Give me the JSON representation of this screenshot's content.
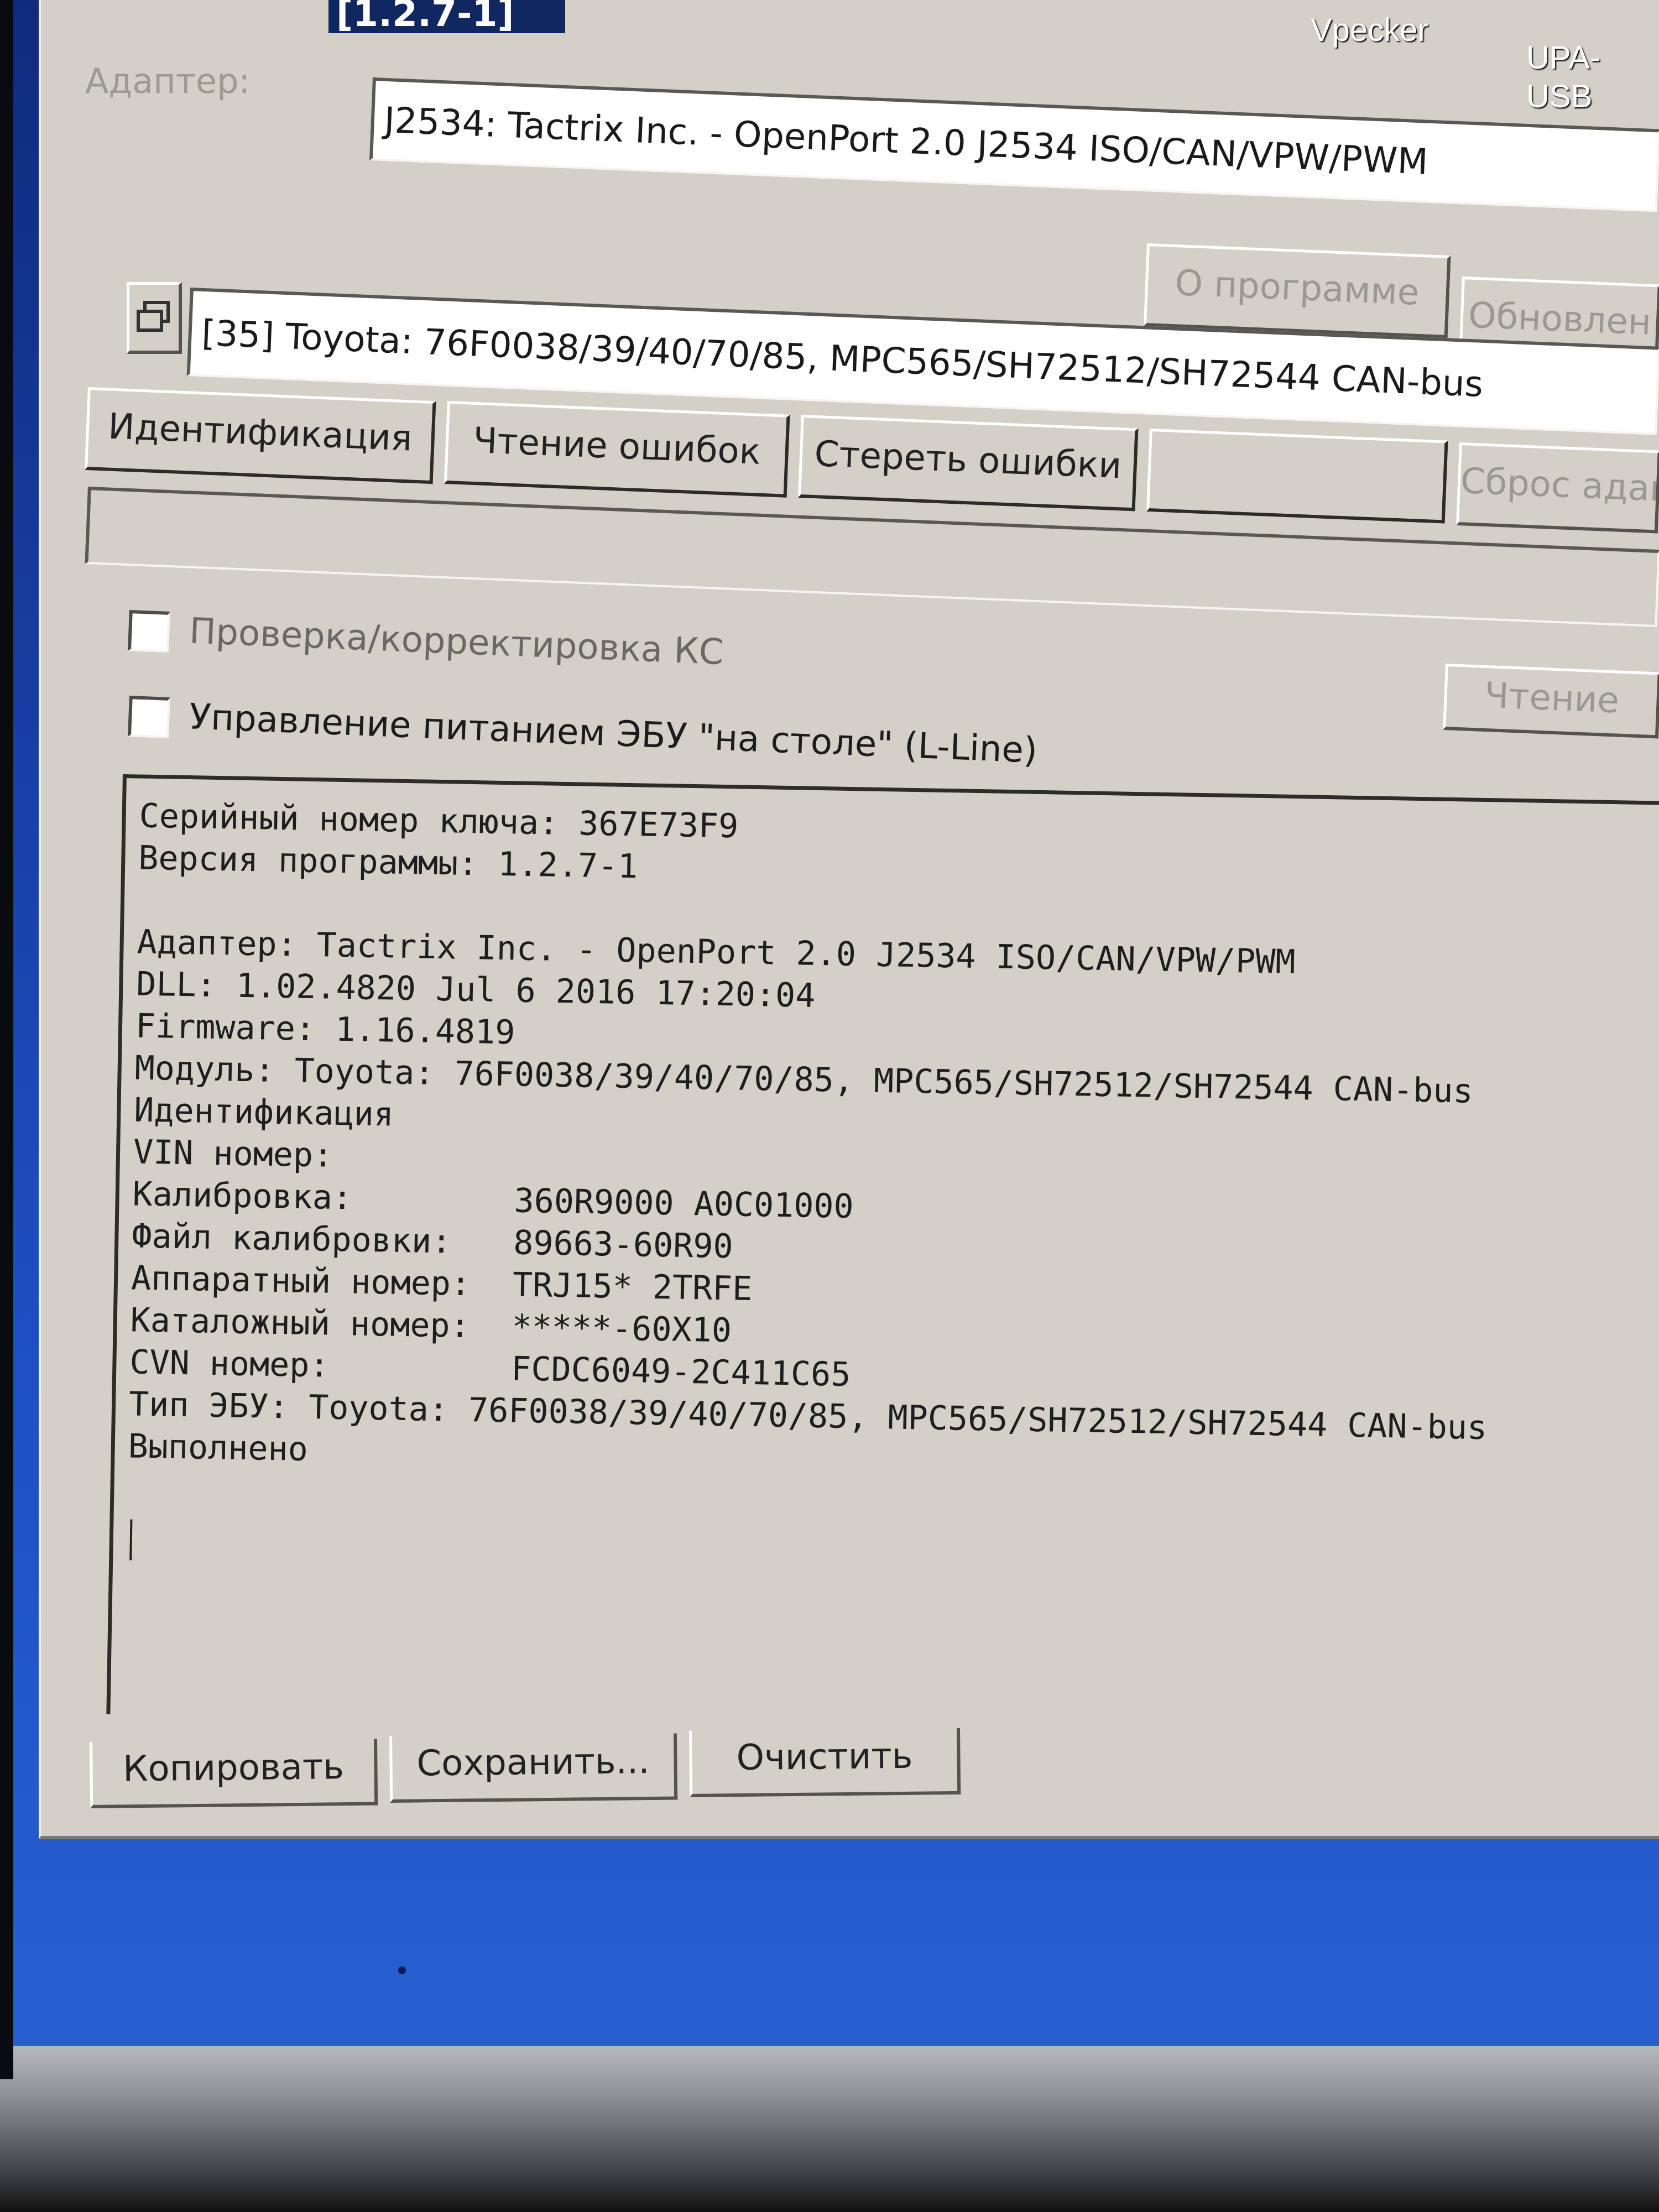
{
  "window": {
    "title": "[1.2.7-1]"
  },
  "desktop": {
    "icons": [
      "Vpecker",
      "UPA-USB"
    ]
  },
  "adapter": {
    "label": "Адаптер:",
    "value": "J2534: Tactrix Inc. - OpenPort 2.0 J2534 ISO/CAN/VPW/PWM"
  },
  "top_buttons": {
    "about": "О программе",
    "update": "Обновлен"
  },
  "module": {
    "value": "[35] Toyota: 76F0038/39/40/70/85, MPC565/SH72512/SH72544 CAN-bus"
  },
  "action_buttons": [
    "Идентификация",
    "Чтение ошибок",
    "Стереть ошибки",
    "",
    "Сброс адапта"
  ],
  "checkboxes": [
    {
      "label": "Проверка/корректировка КС",
      "checked": false
    },
    {
      "label": "Управление питанием ЭБУ \"на столе\" (L-Line)",
      "checked": false
    }
  ],
  "read_button": "Чтение",
  "log": {
    "lines": [
      "Серийный номер ключа: 367E73F9",
      "Версия программы: 1.2.7-1",
      "",
      "Адаптер: Tactrix Inc. - OpenPort 2.0 J2534 ISO/CAN/VPW/PWM",
      "DLL: 1.02.4820 Jul  6 2016 17:20:04",
      "Firmware: 1.16.4819",
      "Модуль: Toyota: 76F0038/39/40/70/85, MPC565/SH72512/SH72544 CAN-bus",
      "Идентификация",
      "VIN номер:"
    ],
    "fields": [
      {
        "key": "Калибровка:",
        "value": "360R9000 A0C01000"
      },
      {
        "key": "Файл калибровки:",
        "value": "89663-60R90"
      },
      {
        "key": "Аппаратный номер:",
        "value": "TRJ15* 2TRFE"
      },
      {
        "key": "Каталожный номер:",
        "value": "*****-60X10"
      },
      {
        "key": "CVN номер:",
        "value": "FCDC6049-2C411C65"
      }
    ],
    "tail": [
      "Тип ЭБУ: Toyota: 76F0038/39/40/70/85, MPC565/SH72512/SH72544 CAN-bus",
      "Выполнено"
    ]
  },
  "bottom_buttons": {
    "copy": "Копировать",
    "save": "Сохранить...",
    "clear": "Очистить"
  }
}
